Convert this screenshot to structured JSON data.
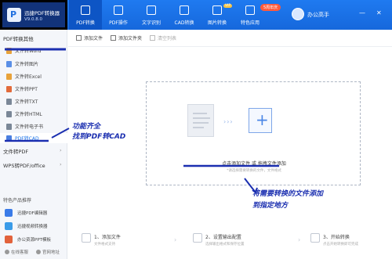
{
  "app": {
    "name": "迅捷PDF转换器",
    "version": "V9.0.8.0",
    "logo_letter": "P"
  },
  "tabs": [
    {
      "label": "PDF转换",
      "icon": "pdf-convert-icon",
      "active": true
    },
    {
      "label": "PDF操作",
      "icon": "pdf-operate-icon"
    },
    {
      "label": "文字识别",
      "icon": "ocr-icon"
    },
    {
      "label": "CAD转换",
      "icon": "cad-icon"
    },
    {
      "label": "图片转换",
      "icon": "image-convert-icon"
    },
    {
      "label": "特色应用",
      "icon": "feature-apps-icon"
    }
  ],
  "header": {
    "vip_badge": "5周年庆",
    "vip2": "VIP",
    "user": "办公高手",
    "minimize": "—",
    "close": "✕"
  },
  "sidebar": {
    "section_title": "PDF转换其他",
    "items": [
      {
        "label": "文件转Word",
        "color": "#e8a23a"
      },
      {
        "label": "文件转图片",
        "color": "#5a8fe6"
      },
      {
        "label": "文件转Excel",
        "color": "#e8a23a"
      },
      {
        "label": "文件转PPT",
        "color": "#e26a3b"
      },
      {
        "label": "文件转TXT",
        "color": "#7a8797"
      },
      {
        "label": "文件转HTML",
        "color": "#7a8797"
      },
      {
        "label": "文件转电子书",
        "color": "#7a8797"
      },
      {
        "label": "PDF转CAD",
        "color": "#4a7fe0",
        "active": true
      }
    ],
    "collapsed_sections": [
      "文件转PDF",
      "WPS转PDF/office"
    ],
    "recommend_title": "特色产品推荐",
    "recommend": [
      {
        "label": "迅捷PDF编辑器",
        "color": "#3a7be8"
      },
      {
        "label": "迅捷视频转换器",
        "color": "#3a9be8"
      },
      {
        "label": "办公资源PPT模板",
        "color": "#e2623b"
      }
    ],
    "footer": {
      "online_service": "在线客服",
      "official_site": "官网地址"
    }
  },
  "toolbar": {
    "add_file": "添加文件",
    "add_folder": "添加文件夹",
    "clear_list": "清空列表"
  },
  "dropzone": {
    "main_text": "点击添加文件 或 拖拽文件添加",
    "sub_text": "*请选择需要转换的文件，文件格式",
    "arrows": "›››",
    "plus": "+"
  },
  "steps": [
    {
      "num": "1、",
      "title": "添加文件",
      "desc": "文件格式支持"
    },
    {
      "num": "2、",
      "title": "设置输出配置",
      "desc": "选择输出格式和保存位置"
    },
    {
      "num": "3、",
      "title": "开始转换",
      "desc": "点击开始转换即可完成"
    }
  ],
  "annotations": {
    "left_line1": "功能齐全",
    "left_line2": "找到PDF转CAD",
    "right_line1": "将需要转换的文件添加",
    "right_line2": "到指定地方"
  },
  "colors": {
    "brand": "#1a73e8",
    "annotation": "#1b2fb0"
  }
}
